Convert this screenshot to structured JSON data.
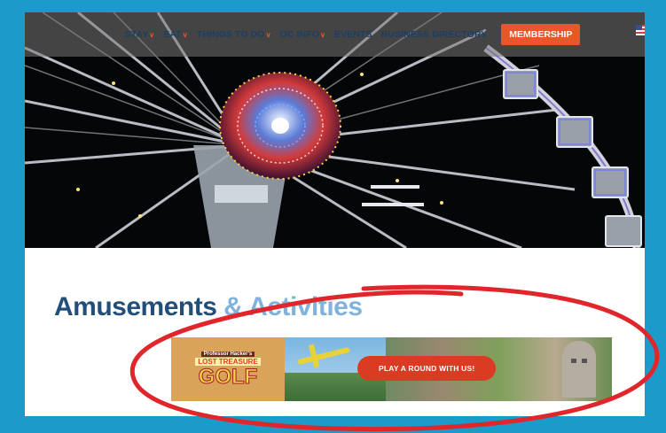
{
  "nav": {
    "items": [
      {
        "label": "STAY",
        "has_dropdown": true
      },
      {
        "label": "EAT",
        "has_dropdown": true
      },
      {
        "label": "THINGS TO DO",
        "has_dropdown": true
      },
      {
        "label": "OC INFO",
        "has_dropdown": true
      },
      {
        "label": "EVENTS",
        "has_dropdown": false
      },
      {
        "label": "BUSINESS DIRECTORY",
        "has_dropdown": false
      }
    ],
    "cta_label": "MEMBERSHIP",
    "dropdown_chevron": "∨",
    "flag_icon": "us-flag-icon"
  },
  "heading": {
    "part1": "Amusements",
    "part2": " & Activities"
  },
  "banner": {
    "logo_line1": "Professor Hacker's",
    "logo_line2": "LOST TREASURE",
    "logo_line3": "GOLF",
    "button_label": "PLAY A ROUND WITH US!"
  },
  "colors": {
    "frame_border": "#1a9bc9",
    "nav_text": "#1b3f63",
    "accent": "#e8562a",
    "heading_primary": "#214f7a",
    "heading_secondary": "#7fb3dd",
    "annotation": "#e0262b"
  }
}
